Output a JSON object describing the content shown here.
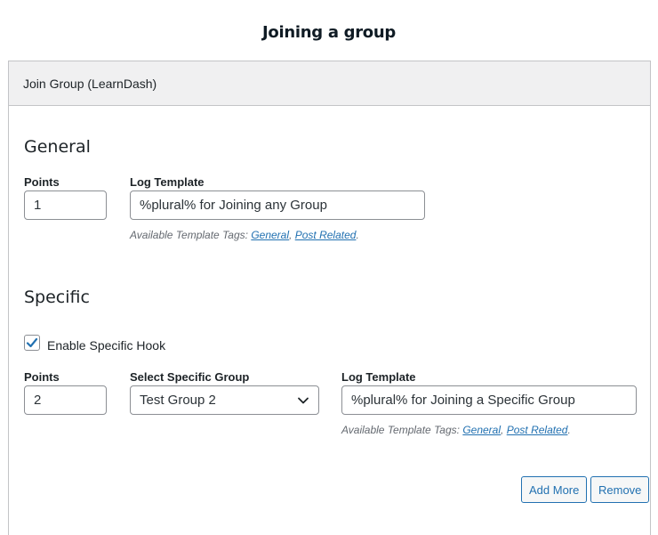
{
  "page_title": "Joining a group",
  "panel": {
    "title": "Join Group (LearnDash)"
  },
  "general": {
    "heading": "General",
    "points_label": "Points",
    "points_value": "1",
    "log_template_label": "Log Template",
    "log_template_value": "%plural% for Joining any Group",
    "tags_prefix": "Available Template Tags:",
    "tag_general": "General",
    "tag_separator": ",",
    "tag_post_related": "Post Related",
    "tags_suffix": "."
  },
  "specific": {
    "heading": "Specific",
    "enable_label": "Enable Specific Hook",
    "enable_checked": true,
    "points_label": "Points",
    "points_value": "2",
    "select_group_label": "Select Specific Group",
    "select_group_value": "Test Group 2",
    "log_template_label": "Log Template",
    "log_template_value": "%plural% for Joining a Specific Group",
    "tags_prefix": "Available Template Tags:",
    "tag_general": "General",
    "tag_separator": ",",
    "tag_post_related": "Post Related",
    "tags_suffix": "."
  },
  "buttons": {
    "add_more": "Add More",
    "remove": "Remove"
  },
  "icons": {
    "select_arrow": "chevron-down-icon",
    "checkbox_mark": "checkmark-icon"
  },
  "colors": {
    "link": "#2271b1",
    "check": "#2271b1",
    "header_bg": "#f0f0f1",
    "border": "#c3c4c7"
  }
}
